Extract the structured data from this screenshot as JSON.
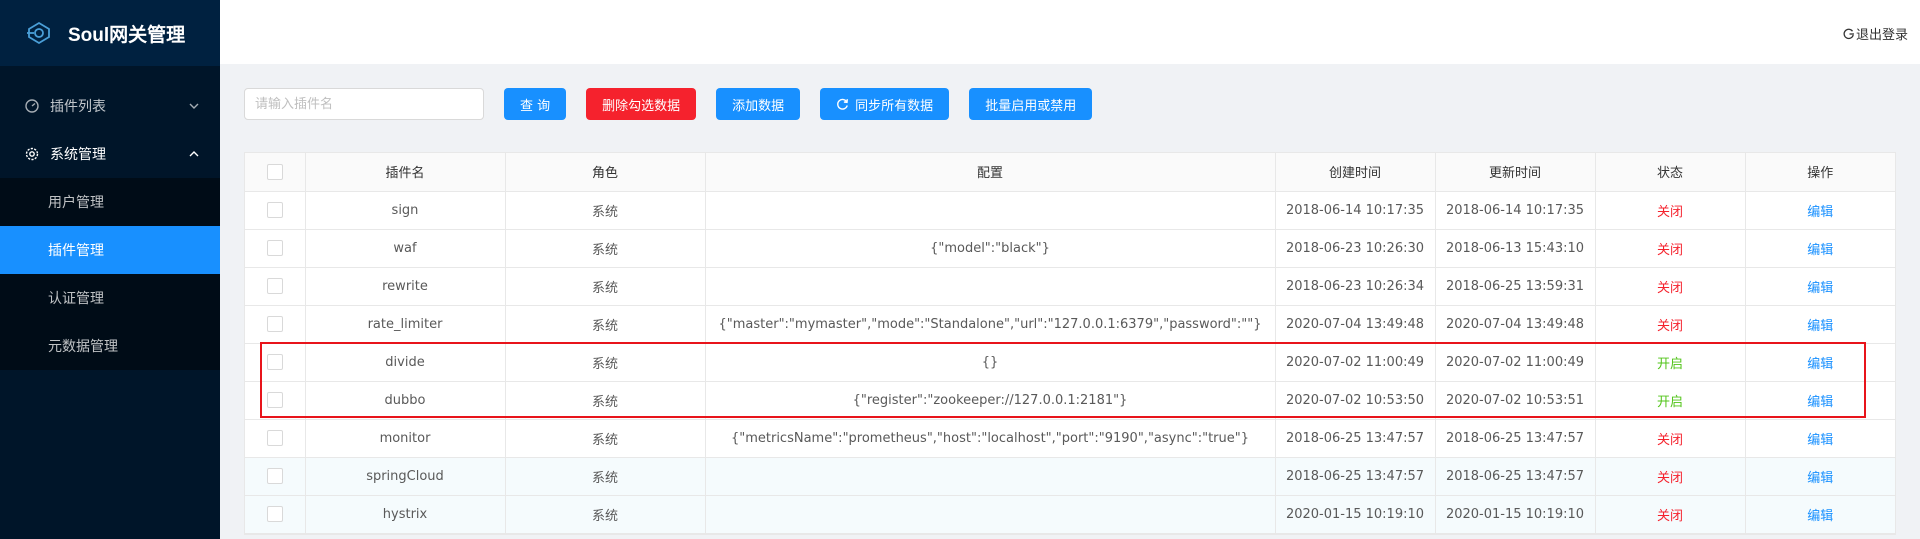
{
  "app": {
    "title": "Soul网关管理"
  },
  "header": {
    "logout_label": "退出登录"
  },
  "sidebar": {
    "items": [
      {
        "label": "插件列表",
        "icon": "dashboard-icon",
        "expanded": false
      },
      {
        "label": "系统管理",
        "icon": "gear-icon",
        "expanded": true,
        "children": [
          {
            "label": "用户管理",
            "active": false
          },
          {
            "label": "插件管理",
            "active": true
          },
          {
            "label": "认证管理",
            "active": false
          },
          {
            "label": "元数据管理",
            "active": false
          }
        ]
      }
    ]
  },
  "toolbar": {
    "search_placeholder": "请输入插件名",
    "query_label": "查 询",
    "delete_label": "删除勾选数据",
    "add_label": "添加数据",
    "sync_label": "同步所有数据",
    "batch_label": "批量启用或禁用"
  },
  "table": {
    "columns": [
      "插件名",
      "角色",
      "配置",
      "创建时间",
      "更新时间",
      "状态",
      "操作"
    ],
    "rows": [
      {
        "name": "sign",
        "role": "系统",
        "config": "",
        "created": "2018-06-14 10:17:35",
        "updated": "2018-06-14 10:17:35",
        "status": "关闭",
        "action": "编辑"
      },
      {
        "name": "waf",
        "role": "系统",
        "config": "{\"model\":\"black\"}",
        "created": "2018-06-23 10:26:30",
        "updated": "2018-06-13 15:43:10",
        "status": "关闭",
        "action": "编辑"
      },
      {
        "name": "rewrite",
        "role": "系统",
        "config": "",
        "created": "2018-06-23 10:26:34",
        "updated": "2018-06-25 13:59:31",
        "status": "关闭",
        "action": "编辑"
      },
      {
        "name": "rate_limiter",
        "role": "系统",
        "config": "{\"master\":\"mymaster\",\"mode\":\"Standalone\",\"url\":\"127.0.0.1:6379\",\"password\":\"\"}",
        "created": "2020-07-04 13:49:48",
        "updated": "2020-07-04 13:49:48",
        "status": "关闭",
        "action": "编辑"
      },
      {
        "name": "divide",
        "role": "系统",
        "config": "{}",
        "created": "2020-07-02 11:00:49",
        "updated": "2020-07-02 11:00:49",
        "status": "开启",
        "action": "编辑"
      },
      {
        "name": "dubbo",
        "role": "系统",
        "config": "{\"register\":\"zookeeper://127.0.0.1:2181\"}",
        "created": "2020-07-02 10:53:50",
        "updated": "2020-07-02 10:53:51",
        "status": "开启",
        "action": "编辑"
      },
      {
        "name": "monitor",
        "role": "系统",
        "config": "{\"metricsName\":\"prometheus\",\"host\":\"localhost\",\"port\":\"9190\",\"async\":\"true\"}",
        "created": "2018-06-25 13:47:57",
        "updated": "2018-06-25 13:47:57",
        "status": "关闭",
        "action": "编辑"
      },
      {
        "name": "springCloud",
        "role": "系统",
        "config": "",
        "created": "2018-06-25 13:47:57",
        "updated": "2018-06-25 13:47:57",
        "status": "关闭",
        "action": "编辑"
      },
      {
        "name": "hystrix",
        "role": "系统",
        "config": "",
        "created": "2020-01-15 10:19:10",
        "updated": "2020-01-15 10:19:10",
        "status": "关闭",
        "action": "编辑"
      }
    ]
  },
  "colors": {
    "primary": "#1890ff",
    "danger": "#f5222d",
    "on": "#52c41a",
    "sidebar": "#001529",
    "highlight": "#e8141b"
  }
}
